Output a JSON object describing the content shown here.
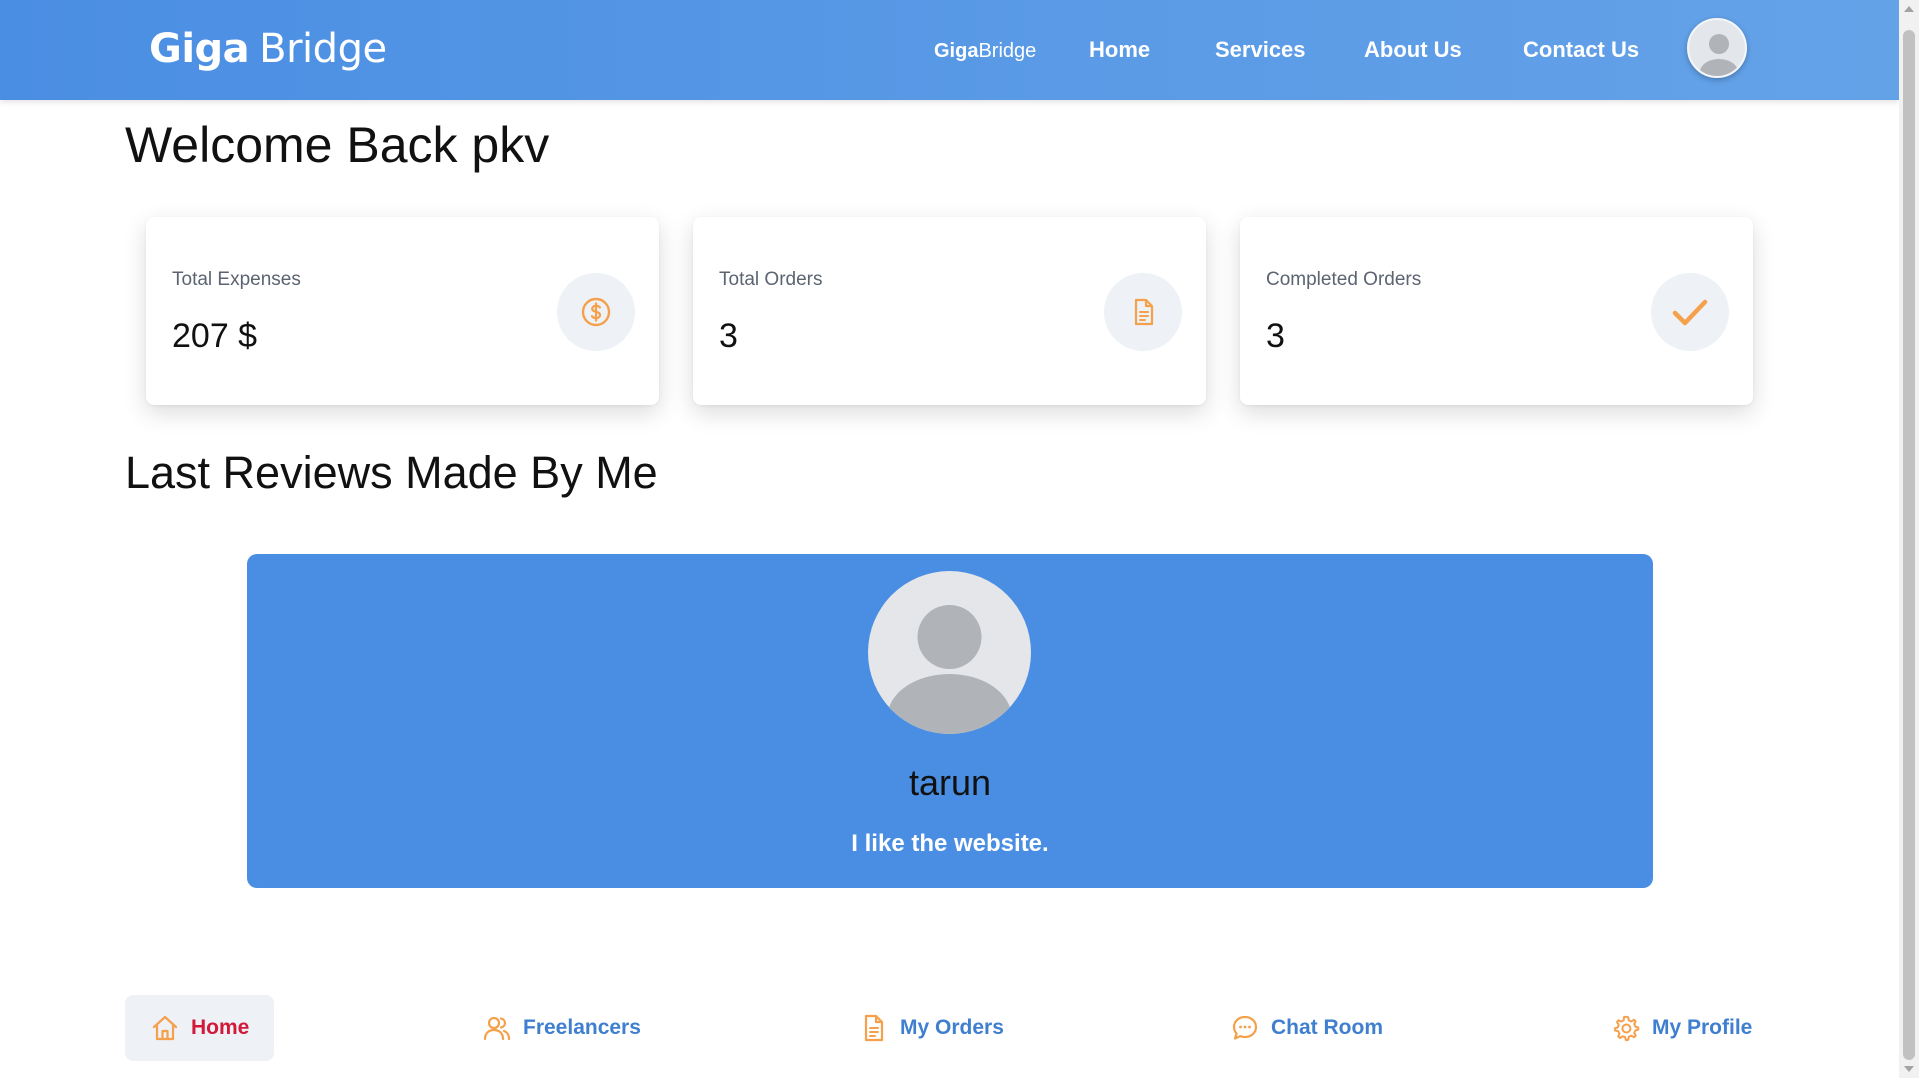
{
  "header": {
    "brand_bold": "Giga",
    "brand_regular": "Bridge",
    "nav_brand_bold": "Giga",
    "nav_brand_regular": "Bridge",
    "nav": [
      "Home",
      "Services",
      "About Us",
      "Contact Us"
    ]
  },
  "welcome": "Welcome Back pkv",
  "stats": [
    {
      "label": "Total Expenses",
      "value": "207 $",
      "icon": "dollar-icon"
    },
    {
      "label": "Total Orders",
      "value": "3",
      "icon": "document-icon"
    },
    {
      "label": "Completed Orders",
      "value": "3",
      "icon": "check-icon"
    }
  ],
  "reviews": {
    "title": "Last Reviews Made By Me",
    "items": [
      {
        "name": "tarun",
        "text": "I like the website."
      }
    ]
  },
  "bottom_nav": [
    {
      "label": "Home",
      "icon": "home-icon",
      "active": true
    },
    {
      "label": "Freelancers",
      "icon": "users-icon"
    },
    {
      "label": "My Orders",
      "icon": "document-icon"
    },
    {
      "label": "Chat Room",
      "icon": "chat-icon"
    },
    {
      "label": "My Profile",
      "icon": "gear-icon"
    }
  ],
  "colors": {
    "header": "#4a8ee3",
    "review_card": "#4a8ee3",
    "icon_accent": "#f5a04b",
    "active_nav": "#d3193a",
    "nav_text": "#3f7fd0"
  }
}
